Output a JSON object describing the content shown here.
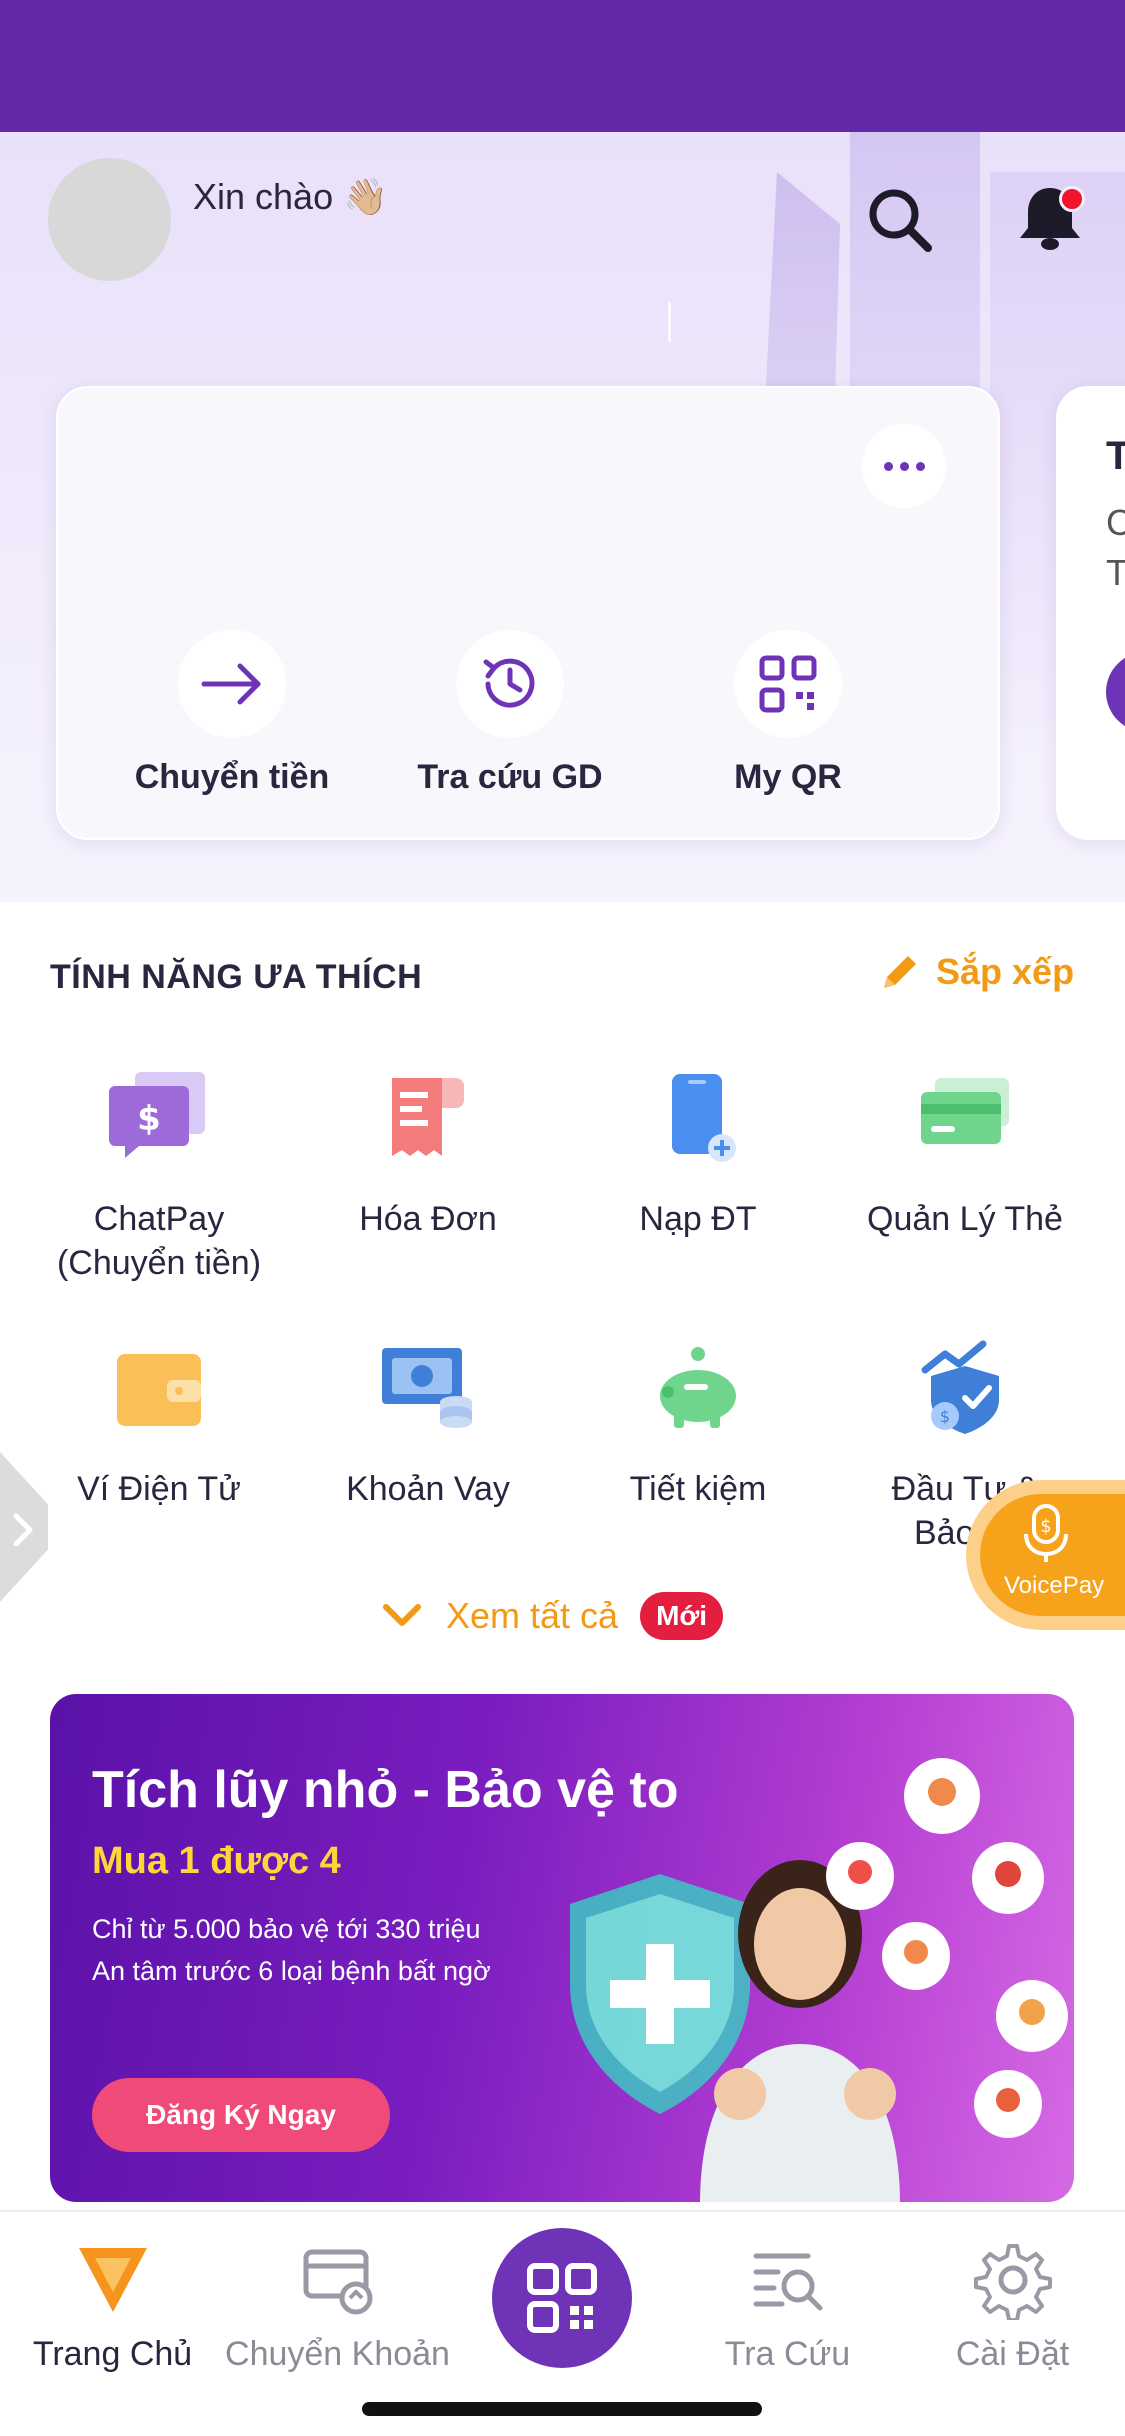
{
  "header": {
    "greeting": "Xin chào 👋🏼",
    "notification_badge_color": "#f0152d"
  },
  "quick_actions": [
    {
      "label": "Chuyển tiền",
      "icon": "arrow-right-icon"
    },
    {
      "label": "Tra cứu GD",
      "icon": "history-clock-icon"
    },
    {
      "label": "My QR",
      "icon": "qr-code-icon"
    }
  ],
  "peek_card": {
    "title": "T",
    "line1": "C",
    "line2": "T"
  },
  "favorites": {
    "title": "TÍNH NĂNG ƯA THÍCH",
    "sort_label": "Sắp xếp",
    "items": [
      {
        "label": "ChatPay\n(Chuyển tiền)",
        "icon": "chat-dollar-icon"
      },
      {
        "label": "Hóa Đơn",
        "icon": "receipt-icon"
      },
      {
        "label": "Nạp ĐT",
        "icon": "phone-topup-icon"
      },
      {
        "label": "Quản Lý Thẻ",
        "icon": "card-icon"
      },
      {
        "label": "Ví Điện Tử",
        "icon": "wallet-icon"
      },
      {
        "label": "Khoản Vay",
        "icon": "loan-cash-icon"
      },
      {
        "label": "Tiết kiệm",
        "icon": "piggy-bank-icon"
      },
      {
        "label": "Đầu Tư &\nBảo Hi",
        "icon": "invest-shield-icon"
      }
    ],
    "see_all_label": "Xem tất cả",
    "new_badge": "Mới"
  },
  "voicepay": {
    "label": "VoicePay"
  },
  "banner": {
    "title": "Tích lũy nhỏ - Bảo vệ to",
    "subtitle": "Mua 1 được 4",
    "line1": "Chỉ từ 5.000 bảo vệ tới 330 triệu",
    "line2": "An tâm trước 6 loại bệnh bất ngờ",
    "cta": "Đăng Ký Ngay"
  },
  "tabbar": {
    "items": [
      {
        "label": "Trang Chủ",
        "icon": "home-logo-icon",
        "active": true
      },
      {
        "label": "Chuyển Khoản",
        "icon": "transfer-icon",
        "active": false
      },
      {
        "label": "",
        "icon": "qr-scan-icon",
        "active": false
      },
      {
        "label": "Tra Cứu",
        "icon": "search-list-icon",
        "active": false
      },
      {
        "label": "Cài Đặt",
        "icon": "gear-icon",
        "active": false
      }
    ]
  },
  "colors": {
    "brand_purple": "#6f33b8",
    "accent_orange": "#f39a14"
  }
}
